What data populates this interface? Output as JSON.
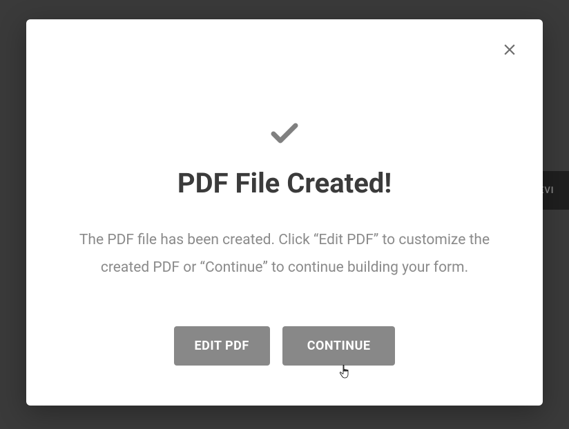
{
  "backdrop": {
    "peek_text": "EVI"
  },
  "modal": {
    "title": "PDF File Created!",
    "description": "The PDF file has been created. Click “Edit PDF” to customize the created PDF or “Continue” to continue building your form.",
    "buttons": {
      "edit_pdf": "EDIT PDF",
      "continue": "CONTINUE"
    }
  }
}
